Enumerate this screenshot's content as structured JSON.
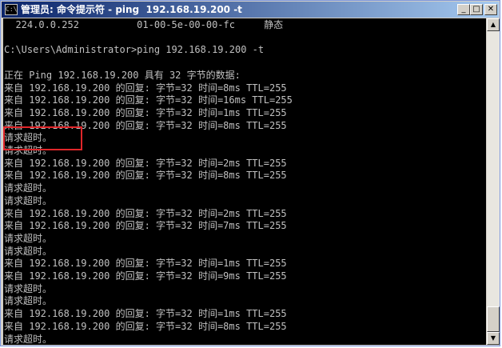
{
  "window": {
    "icon_label": "C:\\",
    "title": "管理员: 命令提示符 - ping  192.168.19.200 -t",
    "minimize": "_",
    "maximize": "□",
    "close": "✕"
  },
  "console": {
    "lines": [
      "  224.0.0.252          01-00-5e-00-00-fc     静态",
      "",
      "C:\\Users\\Administrator>ping 192.168.19.200 -t",
      "",
      "正在 Ping 192.168.19.200 具有 32 字节的数据:",
      "来自 192.168.19.200 的回复: 字节=32 时间=8ms TTL=255",
      "来自 192.168.19.200 的回复: 字节=32 时间=16ms TTL=255",
      "来自 192.168.19.200 的回复: 字节=32 时间=1ms TTL=255",
      "来自 192.168.19.200 的回复: 字节=32 时间=8ms TTL=255",
      "请求超时。",
      "请求超时。",
      "来自 192.168.19.200 的回复: 字节=32 时间=2ms TTL=255",
      "来自 192.168.19.200 的回复: 字节=32 时间=8ms TTL=255",
      "请求超时。",
      "请求超时。",
      "来自 192.168.19.200 的回复: 字节=32 时间=2ms TTL=255",
      "来自 192.168.19.200 的回复: 字节=32 时间=7ms TTL=255",
      "请求超时。",
      "请求超时。",
      "来自 192.168.19.200 的回复: 字节=32 时间=1ms TTL=255",
      "来自 192.168.19.200 的回复: 字节=32 时间=9ms TTL=255",
      "请求超时。",
      "请求超时。",
      "来自 192.168.19.200 的回复: 字节=32 时间=1ms TTL=255",
      "来自 192.168.19.200 的回复: 字节=32 时间=8ms TTL=255",
      "请求超时。"
    ]
  },
  "scrollbar": {
    "up_arrow": "▲",
    "down_arrow": "▼"
  },
  "colors": {
    "highlight": "#e0262a",
    "console_text": "#c0c0c0",
    "console_bg": "#000000"
  }
}
